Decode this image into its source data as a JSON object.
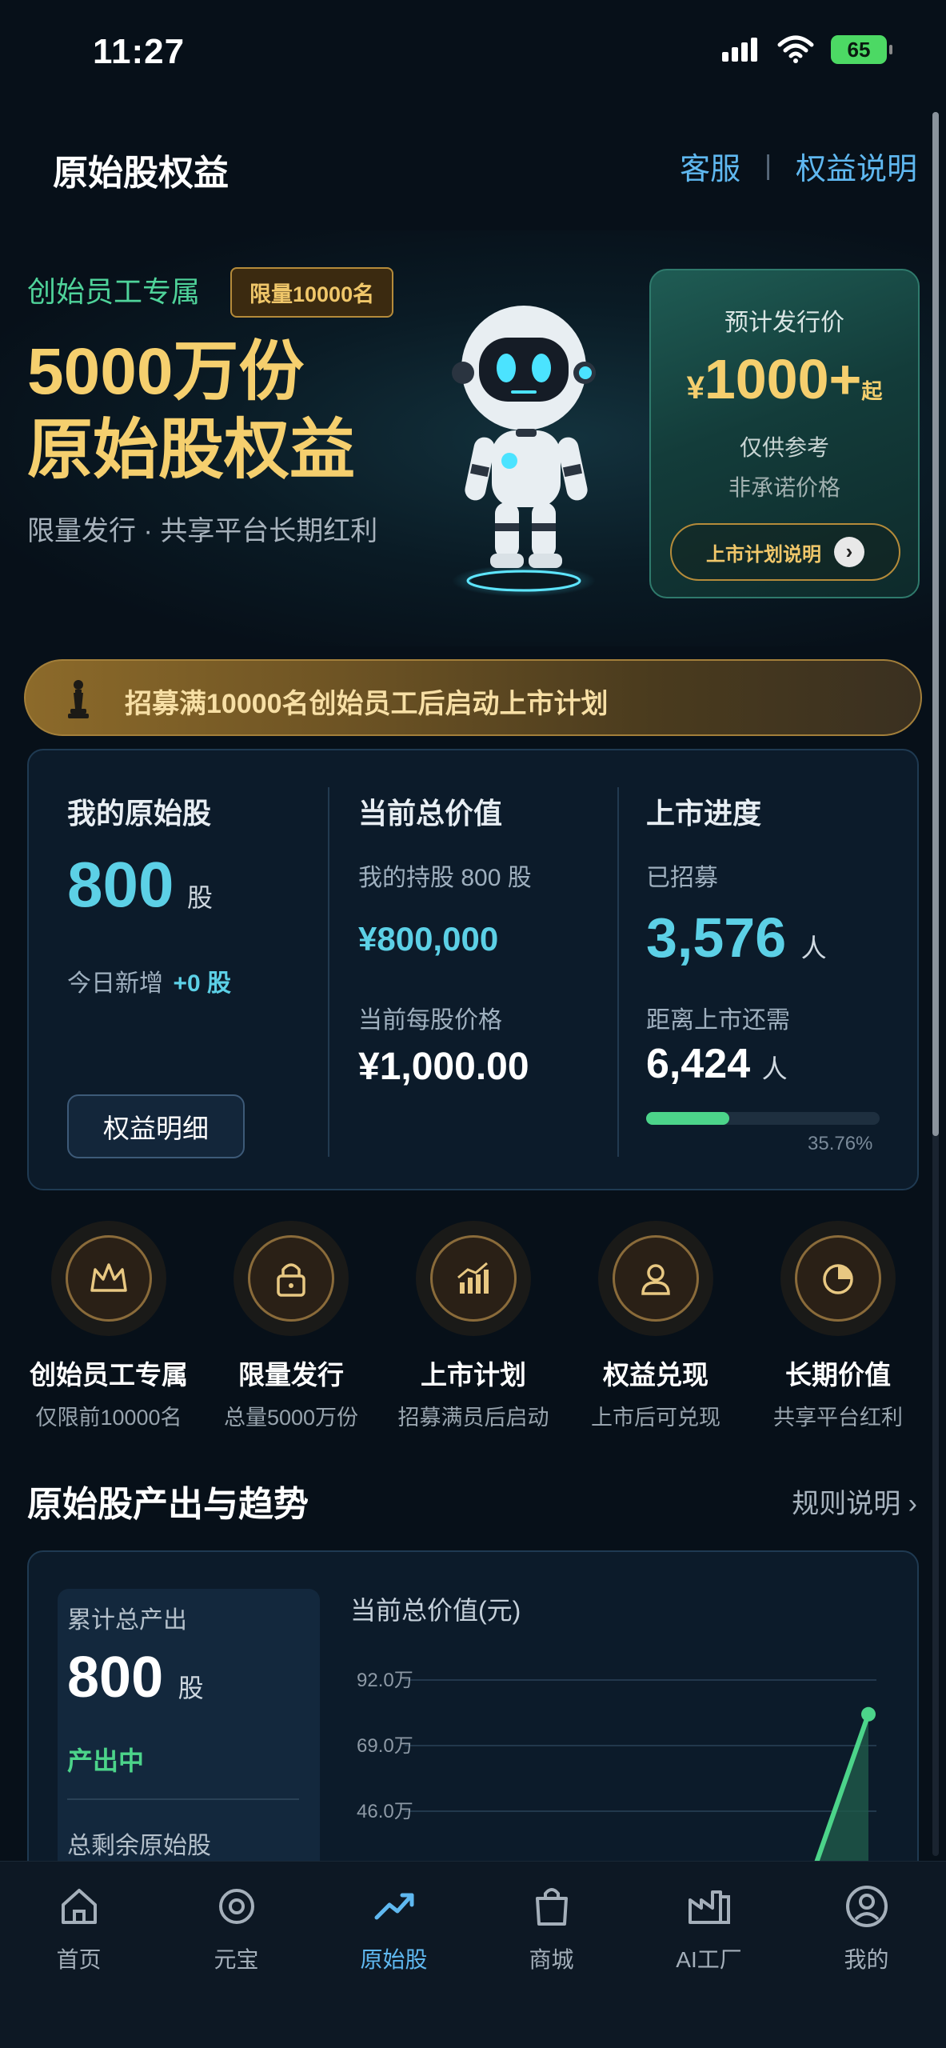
{
  "status_bar": {
    "time": "11:27",
    "battery": "65"
  },
  "header": {
    "title": "原始股权益",
    "customer_service": "客服",
    "separator": "|",
    "rights_info": "权益说明"
  },
  "hero": {
    "tag": "创始员工专属",
    "badge": "限量10000名",
    "title_line1": "5000万份",
    "title_line2": "原始股权益",
    "subtitle": "限量发行 · 共享平台长期红利",
    "price_card": {
      "label": "预计发行价",
      "yen": "¥",
      "value": "1000+",
      "suffix": "起",
      "note1": "仅供参考",
      "note2": "非承诺价格",
      "button": "上市计划说明"
    }
  },
  "banner": {
    "text": "招募满10000名创始员工后启动上市计划"
  },
  "stats": {
    "my_shares": {
      "title": "我的原始股",
      "value": "800",
      "unit": "股",
      "today_label": "今日新增",
      "today_value": "+0 股",
      "button": "权益明细"
    },
    "total_value": {
      "title": "当前总价值",
      "holding_label": "我的持股 800 股",
      "value": "¥800,000",
      "price_label": "当前每股价格",
      "price_value": "¥1,000.00"
    },
    "listing": {
      "title": "上市进度",
      "recruited_label": "已招募",
      "recruited_value": "3,576",
      "recruited_unit": "人",
      "remaining_label": "距离上市还需",
      "remaining_value": "6,424",
      "remaining_unit": "人",
      "progress_percent": 35.76,
      "progress_text": "35.76%"
    }
  },
  "features": [
    {
      "icon": "crown-icon",
      "title": "创始员工专属",
      "sub": "仅限前10000名"
    },
    {
      "icon": "lock-icon",
      "title": "限量发行",
      "sub": "总量5000万份"
    },
    {
      "icon": "growth-chart-icon",
      "title": "上市计划",
      "sub": "招募满员后启动"
    },
    {
      "icon": "user-badge-icon",
      "title": "权益兑现",
      "sub": "上市后可兑现"
    },
    {
      "icon": "pie-chart-icon",
      "title": "长期价值",
      "sub": "共享平台红利"
    }
  ],
  "section": {
    "title": "原始股产出与趋势",
    "link": "规则说明 ›"
  },
  "trend": {
    "total_label": "累计总产出",
    "total_value": "800",
    "total_unit": "股",
    "status": "产出中",
    "remaining_label": "总剩余原始股",
    "chart_title": "当前总价值(元)"
  },
  "chart_data": {
    "type": "line",
    "title": "当前总价值(元)",
    "ytick_labels": [
      "92.0万",
      "69.0万",
      "46.0万"
    ],
    "yticks": [
      92.0,
      69.0,
      46.0
    ],
    "ylim": [
      0,
      100
    ],
    "series": [
      {
        "values": [
          0,
          80
        ]
      }
    ],
    "grid": true
  },
  "tabs": [
    {
      "label": "首页",
      "icon": "home-icon"
    },
    {
      "label": "元宝",
      "icon": "coin-icon"
    },
    {
      "label": "原始股",
      "icon": "trend-up-icon"
    },
    {
      "label": "商城",
      "icon": "shopping-bag-icon"
    },
    {
      "label": "AI工厂",
      "icon": "factory-icon"
    },
    {
      "label": "我的",
      "icon": "profile-icon"
    }
  ],
  "colors": {
    "accent": "#5fb8f0",
    "gold": "#f5cf6e",
    "cyan": "#5cd0e6",
    "green": "#4cd48a",
    "background": "#071019"
  }
}
